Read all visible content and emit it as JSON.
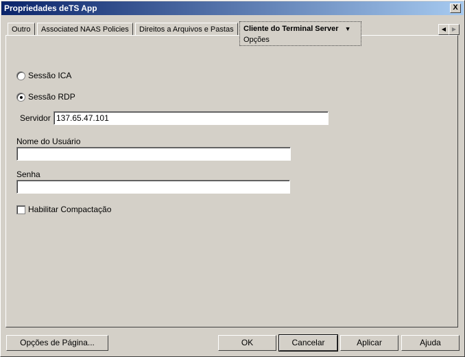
{
  "window": {
    "title": "Propriedades deTS App",
    "close_label": "X"
  },
  "tabs": [
    {
      "label": "Outro"
    },
    {
      "label": "Associated NAAS Policies"
    },
    {
      "label": "Direitos a Arquivos e Pastas"
    },
    {
      "label": "Cliente do Terminal Server",
      "sublabel": "Opções",
      "active": true
    }
  ],
  "form": {
    "radio_ica": "Sessão ICA",
    "radio_rdp": "Sessão RDP",
    "selected": "rdp",
    "server_label": "Servidor",
    "server_value": "137.65.47.101",
    "user_label": "Nome do Usuário",
    "user_value": "",
    "password_label": "Senha",
    "password_value": "",
    "compression_label": "Habilitar Compactação",
    "compression_checked": false
  },
  "buttons": {
    "page_options": "Opções de Página...",
    "ok": "OK",
    "cancel": "Cancelar",
    "apply": "Aplicar",
    "help": "Ajuda"
  }
}
